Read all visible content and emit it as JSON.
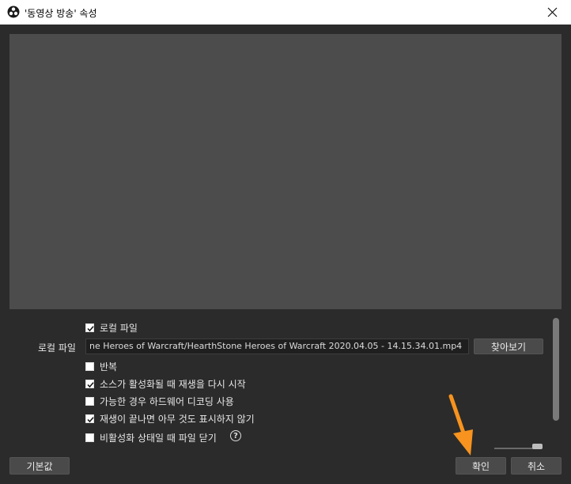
{
  "window": {
    "title": "'동영상 방송' 속성",
    "icon": "obs-logo-icon",
    "close": "close-icon"
  },
  "props": {
    "local_file": {
      "label": "로컬 파일",
      "checked": true
    },
    "file_field": {
      "label": "로컬 파일",
      "value": "ne  Heroes of Warcraft/HearthStone  Heroes of Warcraft 2020.04.05 - 14.15.34.01.mp4",
      "browse_label": "찾아보기"
    },
    "loop": {
      "label": "반복",
      "checked": false
    },
    "restart_on_activate": {
      "label": "소스가 활성화될 때 재생을 다시 시작",
      "checked": true
    },
    "hw_decode": {
      "label": "가능한 경우 하드웨어 디코딩 사용",
      "checked": false
    },
    "hide_on_end": {
      "label": "재생이 끝나면 아무 것도 표시하지 않기",
      "checked": true
    },
    "close_when_inactive": {
      "label": "비활성화 상태일 때 파일 닫기",
      "checked": false,
      "help": "?"
    }
  },
  "footer": {
    "defaults": "기본값",
    "ok": "확인",
    "cancel": "취소"
  },
  "colors": {
    "background": "#2b2b2b",
    "preview": "#4c4c4c",
    "arrow": "#f7931e"
  }
}
